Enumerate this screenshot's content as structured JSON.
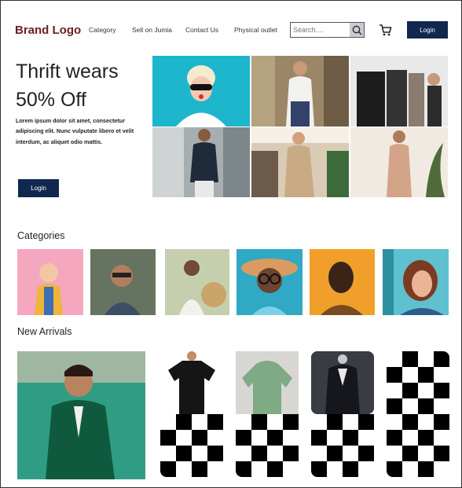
{
  "header": {
    "brand": "Brand Logo",
    "nav": [
      "Category",
      "Sell on Jumia",
      "Contact Us",
      "Physical outlet"
    ],
    "search_placeholder": "Search....",
    "login_label": "Login"
  },
  "hero": {
    "title_line1": "Thrift wears",
    "title_line2": "50% Off",
    "text": "Lorem ipsum dolor sit amet, consectetur adipiscing elit. Nunc vulputate libero et velit interdum, ac aliquet odio mattis.",
    "login_label": "Login"
  },
  "categories": {
    "title": "Categories"
  },
  "new_arrivals": {
    "title": "New Arrivals"
  },
  "colors": {
    "brand": "#6b1e1e",
    "button": "#10284e"
  }
}
